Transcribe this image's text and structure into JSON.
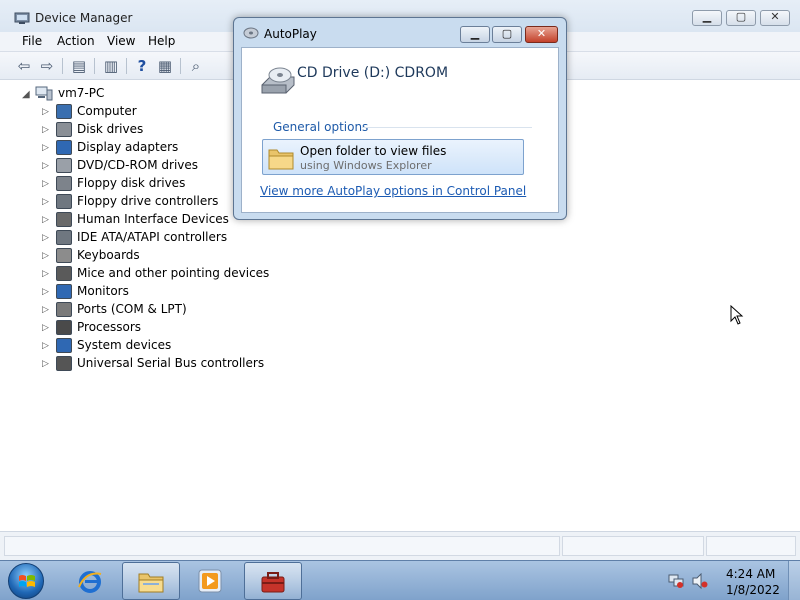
{
  "device_manager": {
    "title": "Device Manager",
    "menu": [
      "File",
      "Action",
      "View",
      "Help"
    ],
    "toolbar_icons": [
      "back-arrow-icon",
      "forward-arrow-icon",
      "console-tree-icon",
      "properties-icon",
      "help-icon",
      "view-icon",
      "scan-hardware-icon"
    ],
    "tree": {
      "root": "vm7-PC",
      "items": [
        {
          "label": "Computer",
          "icon": "computer-icon",
          "color": "#3a6fb0"
        },
        {
          "label": "Disk drives",
          "icon": "disk-drive-icon",
          "color": "#8a8f96"
        },
        {
          "label": "Display adapters",
          "icon": "display-adapter-icon",
          "color": "#2f68b3"
        },
        {
          "label": "DVD/CD-ROM drives",
          "icon": "dvd-drive-icon",
          "color": "#9aa0a8"
        },
        {
          "label": "Floppy disk drives",
          "icon": "floppy-disk-icon",
          "color": "#7d838b"
        },
        {
          "label": "Floppy drive controllers",
          "icon": "floppy-controller-icon",
          "color": "#6f7780"
        },
        {
          "label": "Human Interface Devices",
          "icon": "hid-icon",
          "color": "#6a6a6a"
        },
        {
          "label": "IDE ATA/ATAPI controllers",
          "icon": "ide-controller-icon",
          "color": "#6f7780"
        },
        {
          "label": "Keyboards",
          "icon": "keyboard-icon",
          "color": "#8c8c8c"
        },
        {
          "label": "Mice and other pointing devices",
          "icon": "mouse-icon",
          "color": "#5a5a5a"
        },
        {
          "label": "Monitors",
          "icon": "monitor-icon",
          "color": "#2f68b3"
        },
        {
          "label": "Ports (COM & LPT)",
          "icon": "port-icon",
          "color": "#7a7a7a"
        },
        {
          "label": "Processors",
          "icon": "processor-icon",
          "color": "#4a4a4a"
        },
        {
          "label": "System devices",
          "icon": "system-devices-icon",
          "color": "#2f68b3"
        },
        {
          "label": "Universal Serial Bus controllers",
          "icon": "usb-icon",
          "color": "#555555"
        }
      ]
    }
  },
  "autoplay": {
    "title": "AutoPlay",
    "device": "CD Drive (D:) CDROM",
    "section": "General options",
    "option_title": "Open folder to view files",
    "option_subtitle": "using Windows Explorer",
    "link": "View more AutoPlay options in Control Panel"
  },
  "taskbar": {
    "apps": [
      "internet-explorer-icon",
      "windows-explorer-icon",
      "media-player-icon",
      "device-manager-icon"
    ],
    "time": "4:24 AM",
    "date": "1/8/2022"
  }
}
